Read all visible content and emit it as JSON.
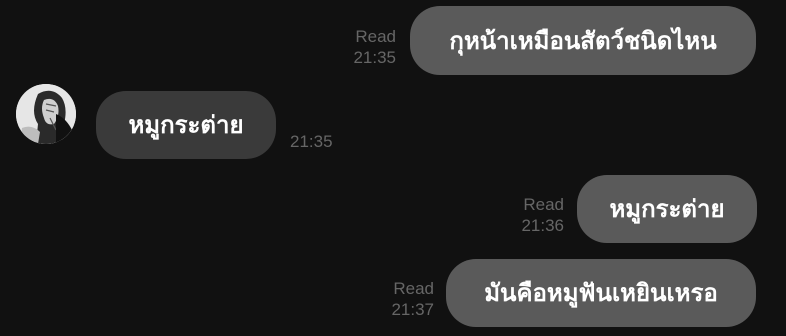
{
  "chat": {
    "messages": [
      {
        "side": "out",
        "text": "กุหน้าเหมือนสัตว์ชนิดไหน",
        "read_label": "Read",
        "time": "21:35"
      },
      {
        "side": "in",
        "text": "หมูกระต่าย",
        "time": "21:35"
      },
      {
        "side": "out",
        "text": "หมูกระต่าย",
        "read_label": "Read",
        "time": "21:36"
      },
      {
        "side": "out",
        "text": "มันคือหมูฟันเหยินเหรอ",
        "read_label": "Read",
        "time": "21:37"
      }
    ]
  },
  "colors": {
    "background": "#111111",
    "outgoing_bubble": "#5a5a5a",
    "incoming_bubble": "#3a3a3a",
    "meta_text": "#666666"
  },
  "icons": {
    "avatar": "profile-photo"
  }
}
